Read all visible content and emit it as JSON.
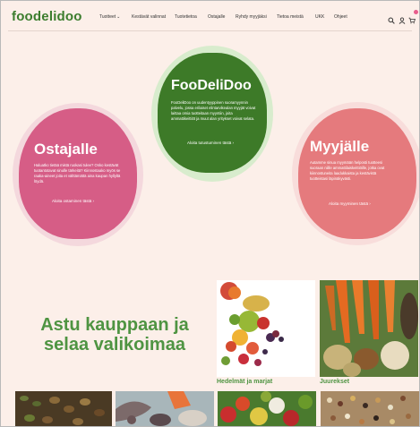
{
  "header": {
    "logo": "foodelidoo",
    "nav": [
      {
        "label": "Tuotteet",
        "has_dropdown": true
      },
      {
        "label": "Kestävät valinnat"
      },
      {
        "label": "Tuotetietoa"
      },
      {
        "label": "Ostajalle"
      },
      {
        "label": "Ryhdy myyjäksi"
      },
      {
        "label": "Tietoa meistä"
      },
      {
        "label": "UKK"
      },
      {
        "label": "Ohjeet"
      }
    ],
    "icons": [
      "search-icon",
      "user-icon",
      "cart-icon"
    ]
  },
  "center": {
    "title": "FooDeliDoo",
    "text": "FooDeliDoo on uudentyyppinen suoramyynnin palvelu, jossa erilaiset elintarvikealan myyjät voivat laittaa omia tuotteitaan myyntiin, joita ammattikeittiöt ja muut alan yritykset voivat selata.",
    "cta": "Aloita tutustuminen tästä ›"
  },
  "left": {
    "title": "Ostajalle",
    "text": "Haluatko tietää mistä ruokasi tulee? Onko kestävät tuotantotavat sinulle tärkeitä? Kiinnostaako myös se raaka-aineet joita et välttämättä aina kaupan hyllyltä löydä.",
    "cta": "Aloita ostaminen tästä ›"
  },
  "right": {
    "title": "Myyjälle",
    "text": "Autamme sinua myymään helposti tuotteesi suoraan niille ammattilaiskeittiöille, jotka ovat kiinnostuneita laadukkaista ja kestävistä tuotteistasi läpinäkyvästi.",
    "cta": "Aloita myyminen tästä ›"
  },
  "hero": {
    "title": "Astu kauppaan ja selaa valikoimaa"
  },
  "categories": [
    {
      "label": "Hedelmät ja marjat"
    },
    {
      "label": "Juurekset"
    }
  ],
  "colors": {
    "background": "#fcefe9",
    "brand_green": "#3d7a28",
    "pink": "#d65d86",
    "salmon": "#e57a7d"
  }
}
